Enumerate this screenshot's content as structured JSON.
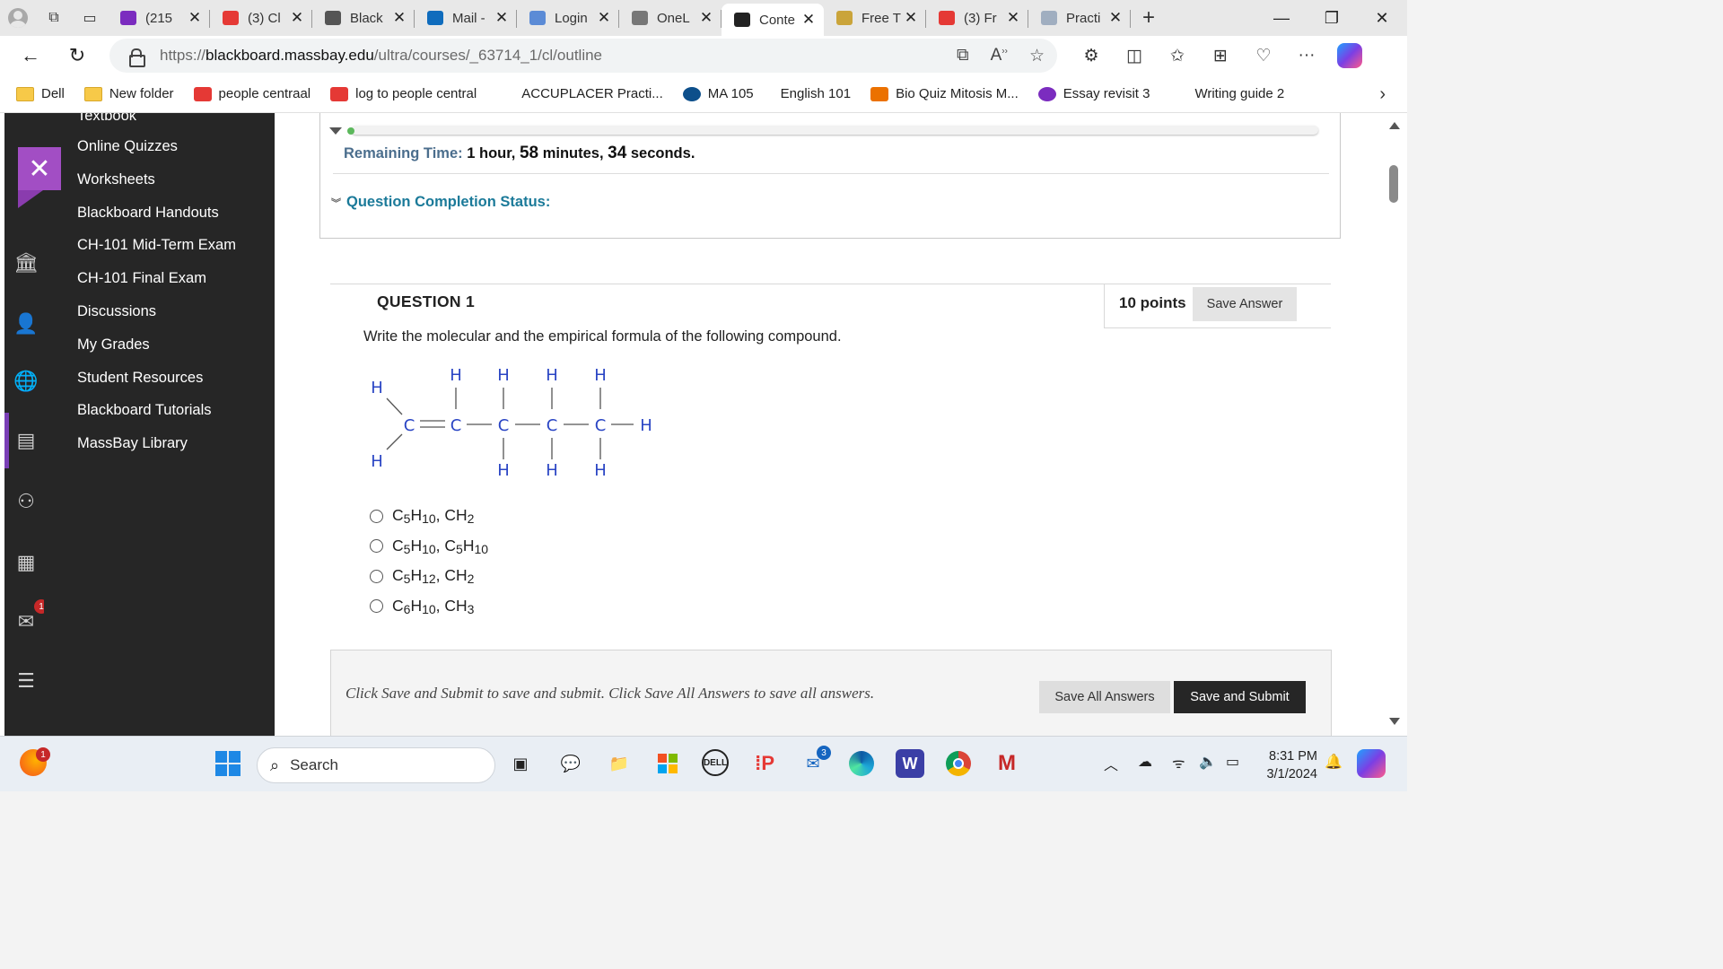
{
  "browser": {
    "tabs": [
      {
        "title": "(215 ",
        "favicon": "mail-icon",
        "color": "#7b2cbf"
      },
      {
        "title": "(3) Cl",
        "favicon": "youtube-icon",
        "color": "#e53935"
      },
      {
        "title": "Black",
        "favicon": "blackboard-icon",
        "color": "#555555"
      },
      {
        "title": "Mail - ",
        "favicon": "outlook-icon",
        "color": "#0f6cbd"
      },
      {
        "title": "Login",
        "favicon": "login-icon",
        "color": "#5b8bd6"
      },
      {
        "title": "OneL",
        "favicon": "onelogin-icon",
        "color": "#777777"
      },
      {
        "title": "Conte",
        "favicon": "blackboard-icon",
        "color": "#222222",
        "active": true
      },
      {
        "title": "Free T",
        "favicon": "check-icon",
        "color": "#caa43a"
      },
      {
        "title": "(3) Fr",
        "favicon": "youtube-icon",
        "color": "#e53935"
      },
      {
        "title": "Practi",
        "favicon": "document-icon",
        "color": "#a0aec0"
      }
    ],
    "url": {
      "scheme": "https://",
      "host": "blackboard.massbay.edu",
      "path": "/ultra/courses/_63714_1/cl/outline"
    },
    "bookmarks": [
      {
        "label": "Dell",
        "icon": "folder-icon"
      },
      {
        "label": "New folder",
        "icon": "folder-icon"
      },
      {
        "label": "people centraal",
        "icon": "people-central-icon"
      },
      {
        "label": "log to people central",
        "icon": "people-central-icon"
      },
      {
        "label": "ACCUPLACER Practi...",
        "icon": "accuplacer-icon"
      },
      {
        "label": "MA 105",
        "icon": "pearson-icon"
      },
      {
        "label": "English 101",
        "icon": "blank-icon"
      },
      {
        "label": "Bio Quiz Mitosis M...",
        "icon": "chegg-icon"
      },
      {
        "label": "Essay revisit 3",
        "icon": "quillbot-icon"
      },
      {
        "label": "Writing guide 2",
        "icon": "writing-icon"
      }
    ]
  },
  "sidebar": {
    "partial_item": "Textbook",
    "items": [
      "Online Quizzes",
      "Worksheets",
      "Blackboard Handouts",
      "CH-101 Mid-Term Exam",
      "CH-101 Final Exam",
      "Discussions",
      "My Grades",
      "Student Resources",
      "Blackboard Tutorials",
      "MassBay Library"
    ],
    "mail_badge": "1"
  },
  "test": {
    "remaining_label": "Remaining Time:",
    "remaining_hours": "1",
    "remaining_hours_unit": "hour,",
    "remaining_minutes": "58",
    "remaining_minutes_unit": "minutes,",
    "remaining_seconds": "34",
    "remaining_seconds_unit": "seconds.",
    "completion_label": "Question Completion Status:",
    "question_title": "QUESTION 1",
    "points": "10 points",
    "save_answer": "Save Answer",
    "question_text": "Write the molecular and the empirical formula of the following compound.",
    "molecule": {
      "carbon": "C",
      "hydrogen": "H"
    },
    "choices": [
      {
        "a": "C",
        "a_sub": "5",
        "b": "H",
        "b_sub": "10",
        "sep": ", ",
        "c": "CH",
        "c_sub": "2",
        "d": "",
        "d_sub": ""
      },
      {
        "a": "C",
        "a_sub": "5",
        "b": "H",
        "b_sub": "10",
        "sep": ", ",
        "c": "C",
        "c_sub": "5",
        "d": "H",
        "d_sub": "10"
      },
      {
        "a": "C",
        "a_sub": "5",
        "b": "H",
        "b_sub": "12",
        "sep": ", ",
        "c": "CH",
        "c_sub": "2",
        "d": "",
        "d_sub": ""
      },
      {
        "a": "C",
        "a_sub": "6",
        "b": "H",
        "b_sub": "10",
        "sep": ", ",
        "c": "CH",
        "c_sub": "3",
        "d": "",
        "d_sub": ""
      }
    ],
    "footer_note": "Click Save and Submit to save and submit. Click Save All Answers to save all answers.",
    "save_all": "Save All Answers",
    "save_submit": "Save and Submit"
  },
  "taskbar": {
    "search_placeholder": "Search",
    "time": "8:31 PM",
    "date": "3/1/2024",
    "mail_badge": "3",
    "widget_badge": "1"
  }
}
